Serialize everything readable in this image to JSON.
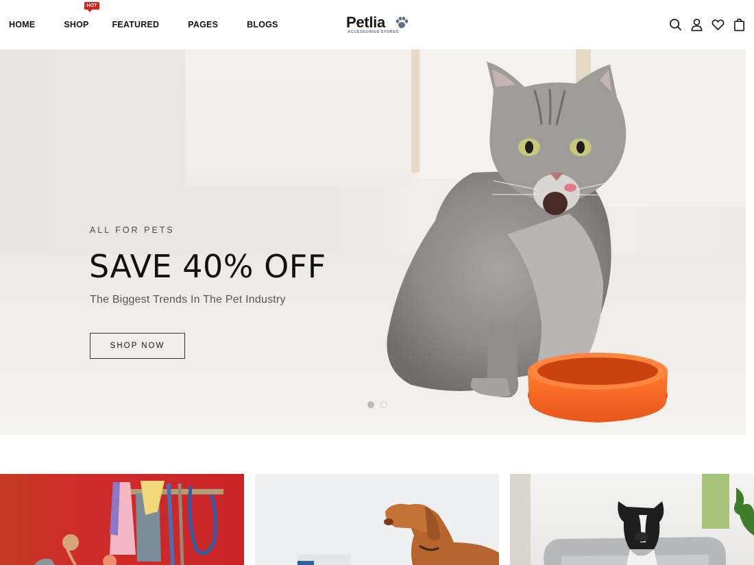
{
  "nav": {
    "items": [
      {
        "label": "HOME"
      },
      {
        "label": "SHOP",
        "badge": "HOT"
      },
      {
        "label": "FEATURED"
      },
      {
        "label": "PAGES"
      },
      {
        "label": "BLOGS"
      }
    ]
  },
  "logo": {
    "name": "Petlia",
    "tagline": "ACCESSORIES STORES",
    "icon": "paw-icon"
  },
  "header_icons": [
    "search-icon",
    "user-icon",
    "heart-icon",
    "shopping-bag-icon"
  ],
  "hero": {
    "eyebrow": "ALL FOR PETS",
    "title": "SAVE 40% OFF",
    "subtitle": "The Biggest Trends In The Pet Industry",
    "button_label": "SHOP NOW",
    "slides_total": 2,
    "active_slide": 1
  },
  "colors": {
    "hot_badge": "#d8241c",
    "logo_accent": "#5b6f8a"
  }
}
